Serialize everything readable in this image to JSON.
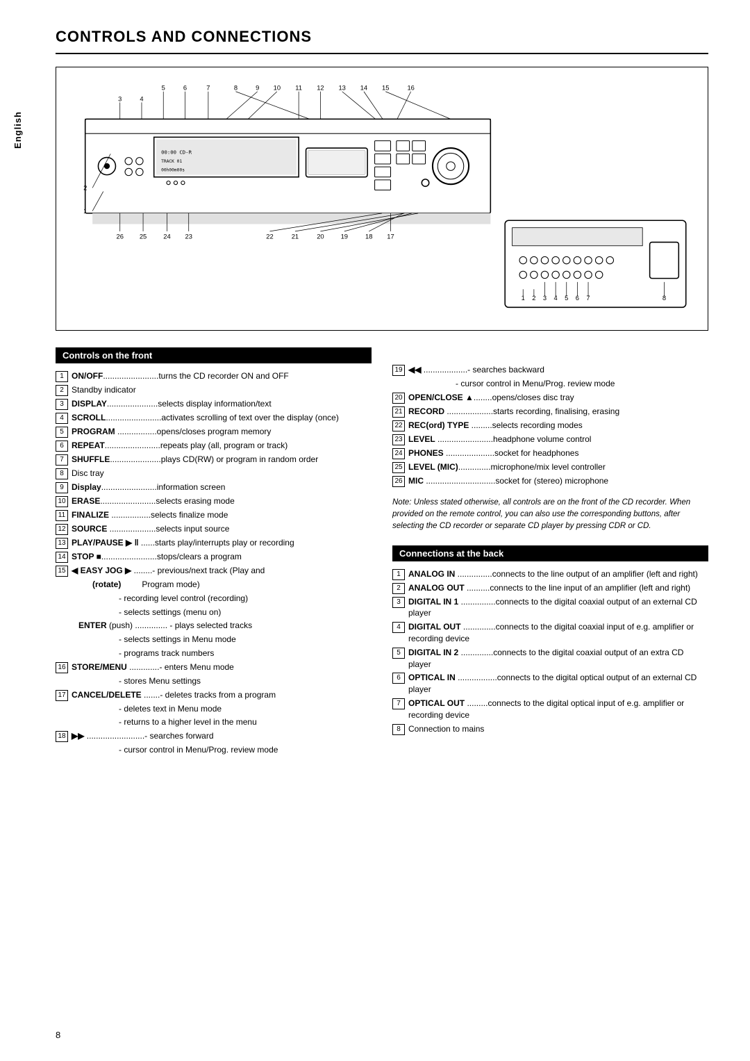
{
  "page": {
    "title": "CONTROLS AND CONNECTIONS",
    "sidebar_label": "English",
    "page_number": "8"
  },
  "sections": {
    "front_controls": {
      "header": "Controls on the front",
      "items": [
        {
          "num": "1",
          "label": "ON/OFF",
          "separator": "........................",
          "desc": "turns the CD recorder ON and OFF"
        },
        {
          "num": "2",
          "label": "",
          "separator": "",
          "desc": "Standby indicator"
        },
        {
          "num": "3",
          "label": "DISPLAY",
          "separator": ".......................",
          "desc": "selects display information/text"
        },
        {
          "num": "4",
          "label": "SCROLL",
          "separator": ".........................",
          "desc": "activates scrolling of text over the display (once)"
        },
        {
          "num": "5",
          "label": "PROGRAM",
          "separator": ".................",
          "desc": "opens/closes program memory"
        },
        {
          "num": "6",
          "label": "REPEAT",
          "separator": ".........................",
          "desc": "repeats play (all, program or track)"
        },
        {
          "num": "7",
          "label": "SHUFFLE",
          "separator": ".......................",
          "desc": "plays CD(RW) or program in random order"
        },
        {
          "num": "8",
          "label": "",
          "separator": "",
          "desc": "Disc tray"
        },
        {
          "num": "9",
          "label": "Display",
          "separator": ".........................",
          "desc": "information screen"
        },
        {
          "num": "10",
          "label": "ERASE",
          "separator": ".........................",
          "desc": "selects erasing mode"
        },
        {
          "num": "11",
          "label": "FINALIZE",
          "separator": "...................",
          "desc": "selects finalize mode"
        },
        {
          "num": "12",
          "label": "SOURCE",
          "separator": ".......................",
          "desc": "selects input source"
        },
        {
          "num": "13",
          "label": "PLAY/PAUSE ▶ ‖",
          "separator": "......",
          "desc": "starts play/interrupts play or recording"
        },
        {
          "num": "14",
          "label": "STOP ■",
          "separator": ".........................",
          "desc": "stops/clears a program"
        },
        {
          "num": "15",
          "label": "◀ EASY JOG ▶",
          "separator": ".........",
          "desc": "- previous/next track (Play and Program mode)"
        },
        {
          "num": "",
          "label": "(rotate)",
          "separator": "",
          "desc": "- recording level control (recording)"
        },
        {
          "num": "",
          "label": "",
          "separator": "",
          "desc": "- selects settings (menu on)"
        },
        {
          "num": "",
          "label": "ENTER (push)",
          "separator": "...............",
          "desc": "- plays selected tracks"
        },
        {
          "num": "",
          "label": "",
          "separator": "",
          "desc": "- selects settings in Menu mode"
        },
        {
          "num": "",
          "label": "",
          "separator": "",
          "desc": "- programs track numbers"
        },
        {
          "num": "16",
          "label": "STORE/MENU",
          "separator": "...............",
          "desc": "- enters Menu mode"
        },
        {
          "num": "",
          "label": "",
          "separator": "",
          "desc": "- stores Menu settings"
        },
        {
          "num": "17",
          "label": "CANCEL/DELETE",
          "separator": "........",
          "desc": "- deletes tracks from a program"
        },
        {
          "num": "",
          "label": "",
          "separator": "",
          "desc": "- deletes text in Menu mode"
        },
        {
          "num": "",
          "label": "",
          "separator": "",
          "desc": "- returns to a higher level in the menu"
        },
        {
          "num": "18",
          "label": "▶▶",
          "separator": ".........................",
          "desc": "- searches forward"
        },
        {
          "num": "",
          "label": "",
          "separator": "",
          "desc": "- cursor control in Menu/Prog. review mode"
        }
      ]
    },
    "front_controls_right": {
      "items": [
        {
          "num": "19",
          "label": "◀◀",
          "separator": ".....................",
          "desc": "- searches backward"
        },
        {
          "num": "",
          "label": "",
          "separator": "",
          "desc": "- cursor control in Menu/Prog. review mode"
        },
        {
          "num": "20",
          "label": "OPEN/CLOSE ▲",
          "separator": ".........",
          "desc": "opens/closes disc tray"
        },
        {
          "num": "21",
          "label": "RECORD",
          "separator": ".......................",
          "desc": "starts recording, finalising, erasing"
        },
        {
          "num": "22",
          "label": "REC(ord) TYPE",
          "separator": "..........",
          "desc": "selects recording modes"
        },
        {
          "num": "23",
          "label": "LEVEL",
          "separator": ".........................",
          "desc": "headphone volume control"
        },
        {
          "num": "24",
          "label": "PHONES",
          "separator": ".....................",
          "desc": "socket for headphones"
        },
        {
          "num": "25",
          "label": "LEVEL (MIC)",
          "separator": "...............",
          "desc": "microphone/mix level controller"
        },
        {
          "num": "26",
          "label": "MIC",
          "separator": "..............................",
          "desc": "socket for (stereo) microphone"
        }
      ]
    },
    "note": "Note: Unless stated otherwise, all controls are on the front of the CD recorder. When provided on the remote control, you can also use the corresponding buttons, after selecting the CD recorder or separate CD player by pressing CDR or CD.",
    "back_connections": {
      "header": "Connections at the back",
      "items": [
        {
          "num": "1",
          "label": "ANALOG IN",
          "separator": "...............",
          "desc": "connects to the line output of an amplifier (left and right)"
        },
        {
          "num": "2",
          "label": "ANALOG OUT",
          "separator": "..........",
          "desc": "connects to the line input of an amplifier (left and right)"
        },
        {
          "num": "3",
          "label": "DIGITAL IN 1",
          "separator": "...............",
          "desc": "connects to the digital coaxial output of an external CD player"
        },
        {
          "num": "4",
          "label": "DIGITAL OUT",
          "separator": "..............",
          "desc": "connects to the digital coaxial input of e.g. amplifier or recording device"
        },
        {
          "num": "5",
          "label": "DIGITAL IN 2",
          "separator": "..............",
          "desc": "connects to the digital coaxial output of an extra CD player"
        },
        {
          "num": "6",
          "label": "OPTICAL IN",
          "separator": ".................",
          "desc": "connects to the digital optical output of an external CD player"
        },
        {
          "num": "7",
          "label": "OPTICAL OUT",
          "separator": ".........",
          "desc": "connects to the digital optical input of e.g. amplifier or recording device"
        },
        {
          "num": "8",
          "label": "",
          "separator": "",
          "desc": "Connection to mains"
        }
      ]
    }
  }
}
